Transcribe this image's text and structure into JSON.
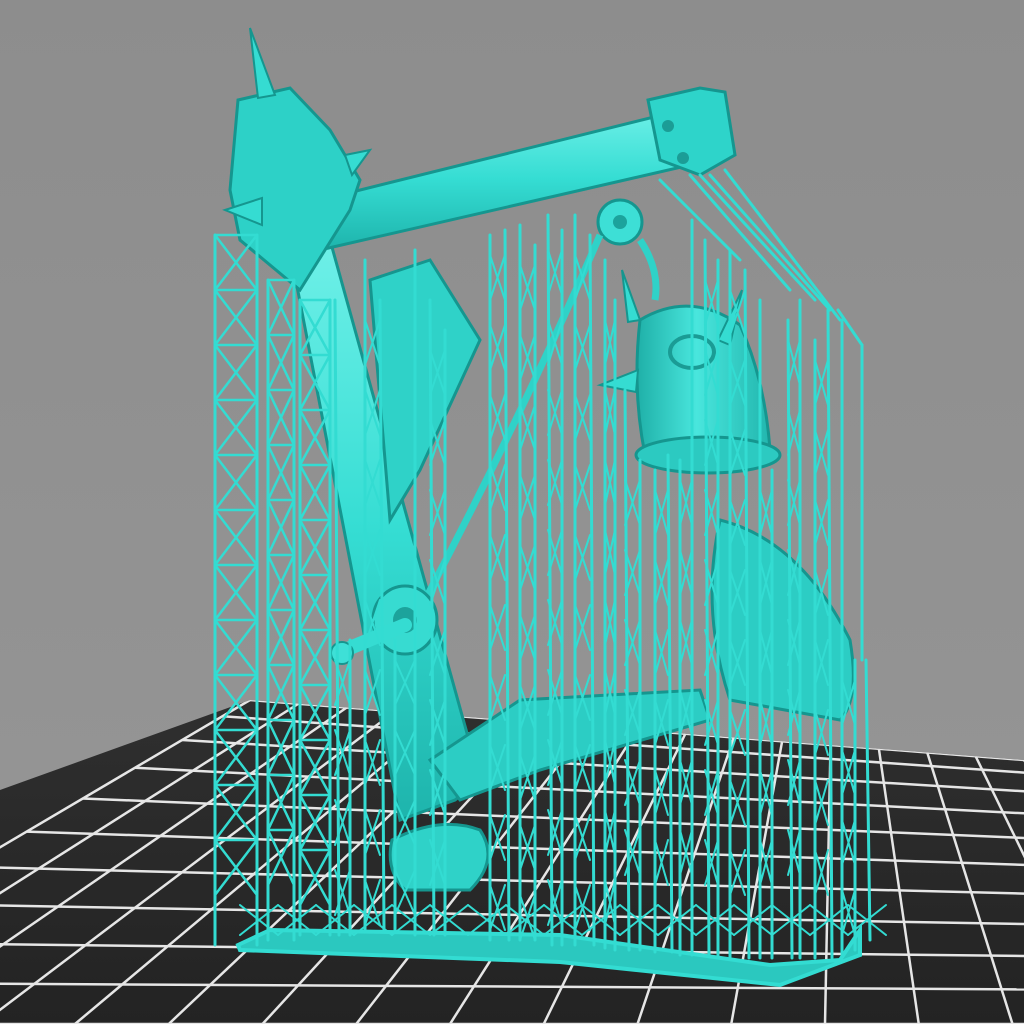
{
  "viewport": {
    "background": "#8f8f8f",
    "bed_color": "#2b2b2b",
    "grid_color": "#e8e8e8",
    "model_color": "#39e0d6",
    "model_shadow": "#1aa79f",
    "model_highlight": "#7cf3ec"
  },
  "scene": {
    "object": "3d-printable-model-with-support-lattice",
    "view": "perspective",
    "grid": true
  }
}
